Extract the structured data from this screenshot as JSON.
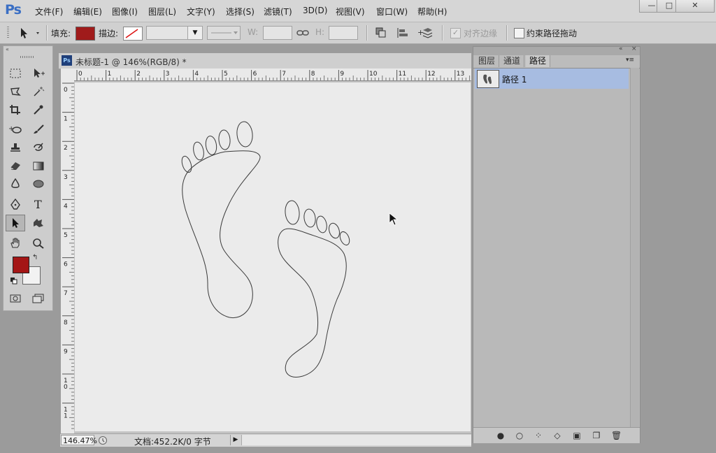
{
  "app": {
    "logo": "Ps"
  },
  "menu": [
    "文件(F)",
    "编辑(E)",
    "图像(I)",
    "图层(L)",
    "文字(Y)",
    "选择(S)",
    "滤镜(T)",
    "3D(D)",
    "视图(V)",
    "窗口(W)",
    "帮助(H)"
  ],
  "window_controls": {
    "minimize": "—",
    "maximize": "□",
    "close": "✕"
  },
  "options": {
    "fill_label": "填充:",
    "stroke_label": "描边:",
    "fill_color": "#a01b1b",
    "w_label": "W:",
    "h_label": "H:",
    "align_edges_label": "对齐边缘",
    "constrain_label": "约束路径拖动"
  },
  "document": {
    "tab_title": "未标题-1 @ 146%(RGB/8) *",
    "ps_badge": "Ps",
    "h_ruler_ticks": [
      "0",
      "1",
      "2",
      "3",
      "4",
      "5",
      "6",
      "7",
      "8",
      "9",
      "10",
      "11",
      "12",
      "13"
    ],
    "v_ruler_ticks": [
      "0",
      "1",
      "2",
      "3",
      "4",
      "5",
      "6",
      "7",
      "8",
      "9",
      "1\n0",
      "1\n1"
    ]
  },
  "status": {
    "zoom": "146.47%",
    "doc_info": "文档:452.2K/0 字节"
  },
  "colors": {
    "foreground": "#a41616",
    "background": "#f2f2f2",
    "selection": "#a7bce1"
  },
  "panel": {
    "tabs": [
      "图层",
      "通道",
      "路径"
    ],
    "active_tab": "路径",
    "paths": [
      {
        "name": "路径 1"
      }
    ],
    "footer_icons": [
      "fill-path-icon",
      "stroke-path-icon",
      "load-selection-icon",
      "make-work-path-icon",
      "add-mask-icon",
      "new-path-icon",
      "delete-path-icon"
    ]
  }
}
